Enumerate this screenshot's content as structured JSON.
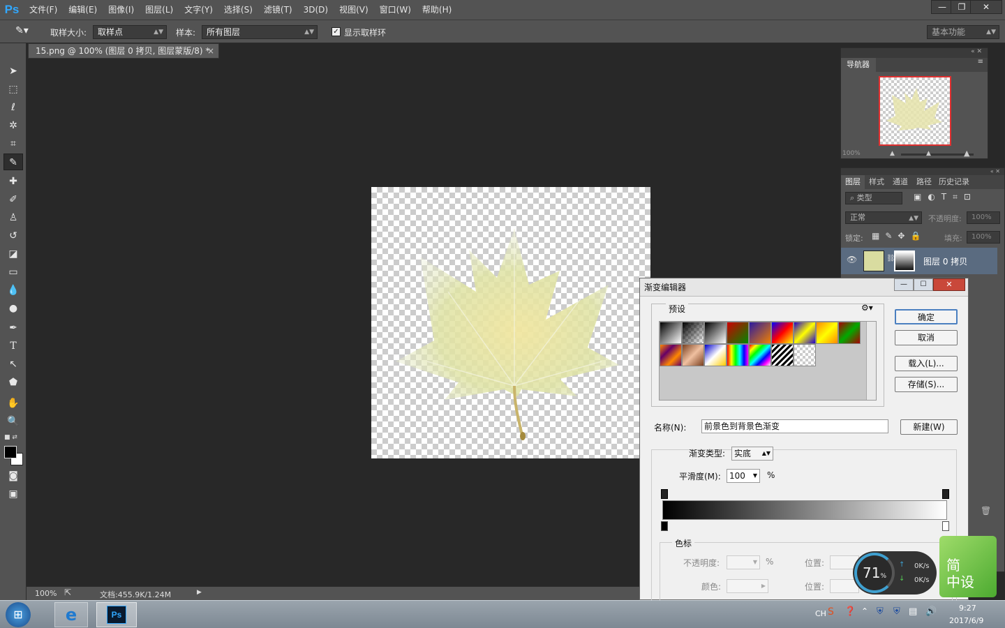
{
  "app": {
    "logo": "Ps"
  },
  "menu": [
    "文件(F)",
    "编辑(E)",
    "图像(I)",
    "图层(L)",
    "文字(Y)",
    "选择(S)",
    "滤镜(T)",
    "3D(D)",
    "视图(V)",
    "窗口(W)",
    "帮助(H)"
  ],
  "window_controls": {
    "minimize": "—",
    "restore": "❐",
    "close": "✕"
  },
  "options": {
    "sample_size_label": "取样大小:",
    "sample_size_value": "取样点",
    "sample_label": "样本:",
    "sample_value": "所有图层",
    "show_ring_label": "显示取样环",
    "show_ring_checked": true,
    "workspace": "基本功能"
  },
  "document_tab": {
    "title": "15.png @ 100% (图层 0 拷贝, 图层蒙版/8) *",
    "close": "×"
  },
  "status": {
    "zoom": "100%",
    "doc_info": "文档:455.9K/1.24M"
  },
  "navigator": {
    "tab": "导航器",
    "zoom": "100%"
  },
  "layers_panel": {
    "tabs": [
      "图层",
      "样式",
      "通道",
      "路径",
      "历史记录"
    ],
    "filter_label": "类型",
    "blend_mode": "正常",
    "opacity_label": "不透明度:",
    "opacity_value": "100%",
    "lock_label": "锁定:",
    "fill_label": "填充:",
    "fill_value": "100%",
    "layer_name": "图层 0 拷贝"
  },
  "gradient_editor": {
    "title": "渐变编辑器",
    "presets_label": "预设",
    "ok": "确定",
    "cancel": "取消",
    "load": "载入(L)...",
    "save": "存储(S)...",
    "name_label": "名称(N):",
    "name_value": "前景色到背景色渐变",
    "new_button": "新建(W)",
    "type_label": "渐变类型:",
    "type_value": "实底",
    "smoothness_label": "平滑度(M):",
    "smoothness_value": "100",
    "smoothness_unit": "%",
    "stops_label": "色标",
    "stop_opacity_label": "不透明度:",
    "stop_opacity_unit": "%",
    "stop_position_label": "位置:",
    "stop_color_label": "颜色:",
    "stop_position2_label": "位置:"
  },
  "widget": {
    "percent": "71",
    "unit": "%",
    "up": "0K/s",
    "down": "0K/s",
    "badge_line1": "简",
    "badge_line2": "中设"
  },
  "taskbar": {
    "lang": "CH",
    "time": "9:27",
    "date": "2017/6/9"
  },
  "colors": {
    "ui_bg": "#535353",
    "canvas_bg": "#282828",
    "accent": "#31a8ff",
    "selected_layer": "#5a6b80"
  }
}
